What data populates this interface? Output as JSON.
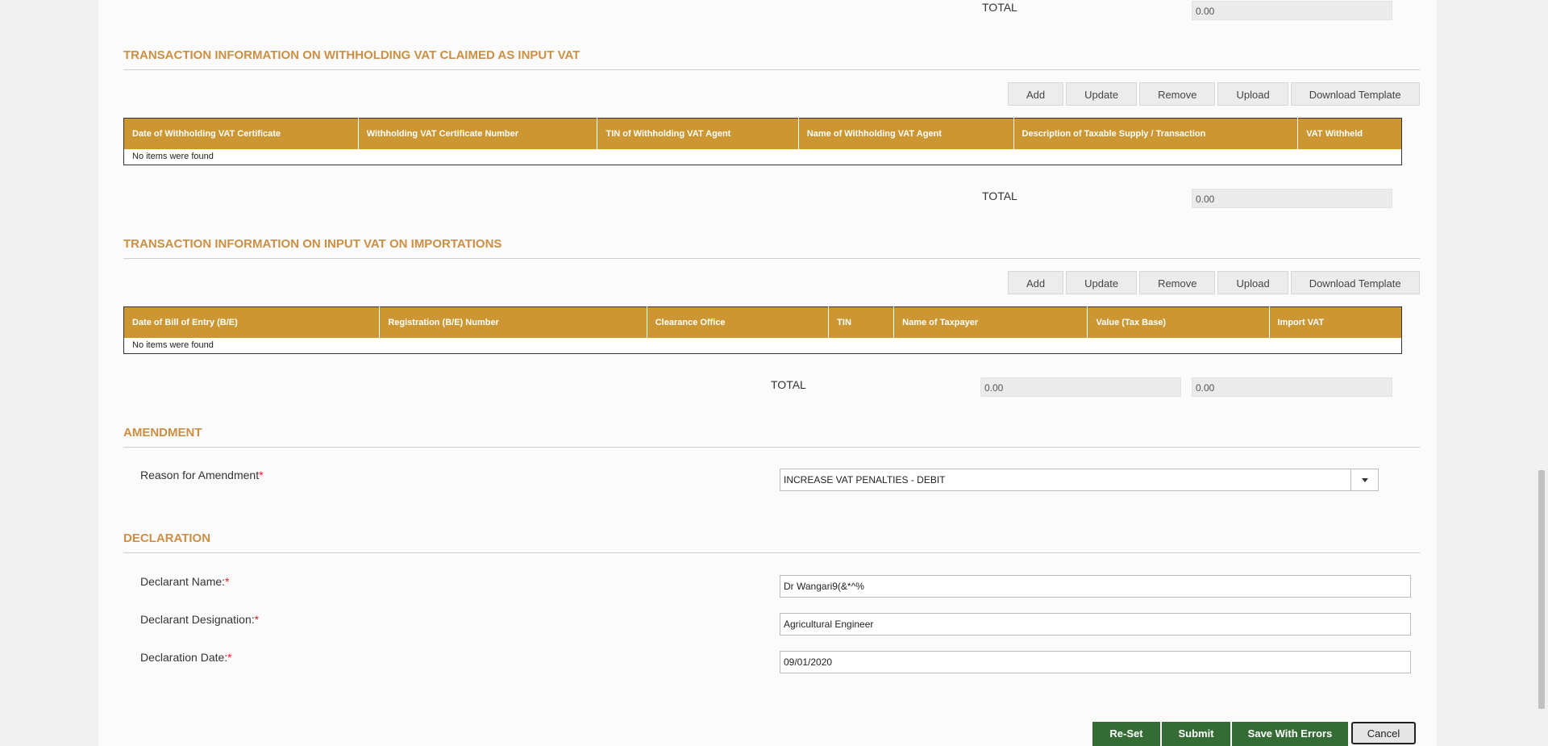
{
  "top_total": {
    "label": "TOTAL",
    "value": "0.00"
  },
  "withholding": {
    "title": "TRANSACTION INFORMATION ON WITHHOLDING VAT CLAIMED AS INPUT VAT",
    "buttons": {
      "add": "Add",
      "update": "Update",
      "remove": "Remove",
      "upload": "Upload",
      "download": "Download Template"
    },
    "columns": [
      "Date of Withholding VAT Certificate",
      "Withholding VAT Certificate Number",
      "TIN of Withholding VAT Agent",
      "Name of Withholding VAT Agent",
      "Description of Taxable Supply / Transaction",
      "VAT Withheld"
    ],
    "empty": "No items were found",
    "total_label": "TOTAL",
    "total_value": "0.00"
  },
  "importations": {
    "title": "TRANSACTION INFORMATION ON INPUT VAT ON IMPORTATIONS",
    "buttons": {
      "add": "Add",
      "update": "Update",
      "remove": "Remove",
      "upload": "Upload",
      "download": "Download Template"
    },
    "columns": [
      "Date of Bill of Entry (B/E)",
      "Registration (B/E) Number",
      "Clearance Office",
      "TIN",
      "Name of Taxpayer",
      "Value (Tax Base)",
      "Import VAT"
    ],
    "empty": "No items were found",
    "total_label": "TOTAL",
    "total_value_1": "0.00",
    "total_value_2": "0.00"
  },
  "amendment": {
    "title": "AMENDMENT",
    "reason_label": "Reason for Amendment",
    "reason_value": "INCREASE VAT PENALTIES - DEBIT"
  },
  "declaration": {
    "title": "DECLARATION",
    "name_label": "Declarant Name:",
    "name_value": "Dr Wangari9(&*^%",
    "designation_label": "Declarant Designation:",
    "designation_value": "Agricultural Engineer",
    "date_label": "Declaration Date:",
    "date_value": "09/01/2020"
  },
  "required_mark": "*",
  "actions": {
    "reset": "Re-Set",
    "submit": "Submit",
    "save_errors": "Save With Errors",
    "cancel": "Cancel"
  }
}
